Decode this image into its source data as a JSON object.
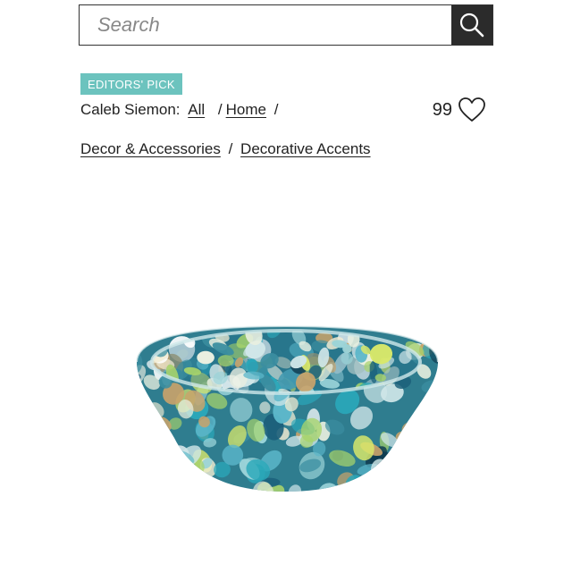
{
  "search": {
    "placeholder": "Search",
    "icon": "search-icon"
  },
  "badge": {
    "label": "EDITORS' PICK",
    "color": "#6cc3be"
  },
  "breadcrumb": {
    "seller": "Caleb Siemon:",
    "items": [
      "All",
      "Home",
      "Decor & Accessories",
      "Decorative Accents"
    ],
    "separator": "/"
  },
  "favorites": {
    "count": "99",
    "icon": "heart-icon"
  },
  "product": {
    "image": "glass-bowl-image"
  }
}
